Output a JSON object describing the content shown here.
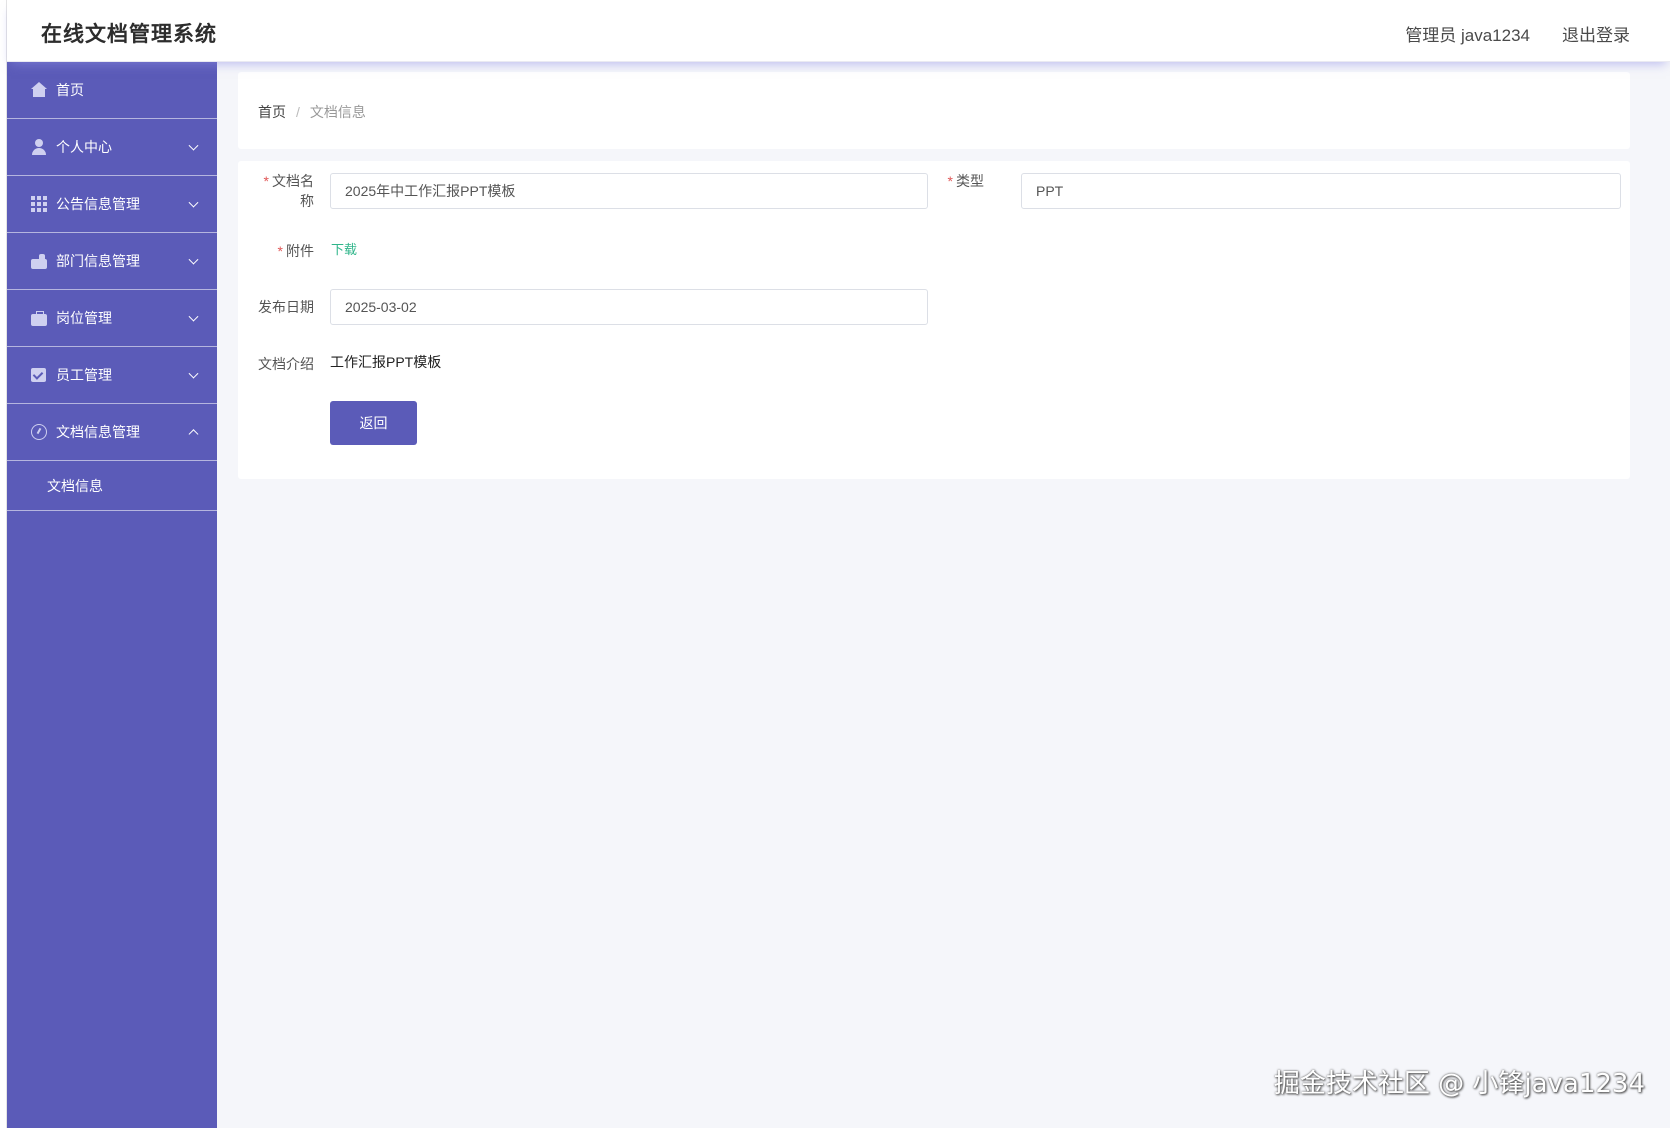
{
  "header": {
    "app_title": "在线文档管理系统",
    "user": "管理员 java1234",
    "logout": "退出登录"
  },
  "sidebar": {
    "items": [
      {
        "label": "首页",
        "icon": "home-icon"
      },
      {
        "label": "个人中心",
        "icon": "user-icon"
      },
      {
        "label": "公告信息管理",
        "icon": "grid-icon"
      },
      {
        "label": "部门信息管理",
        "icon": "thumb-icon"
      },
      {
        "label": "岗位管理",
        "icon": "briefcase-icon"
      },
      {
        "label": "员工管理",
        "icon": "checkbox-icon"
      },
      {
        "label": "文档信息管理",
        "icon": "gauge-icon"
      }
    ],
    "submenu": [
      "文档信息"
    ]
  },
  "breadcrumb": {
    "home": "首页",
    "separator": "/",
    "current": "文档信息"
  },
  "form": {
    "required_mark": "*",
    "doc_name_label": "文档名称",
    "doc_name_value": "2025年中工作汇报PPT模板",
    "type_label": "类型",
    "type_value": "PPT",
    "attachment_label": "附件",
    "attachment_link": "下载",
    "date_label": "发布日期",
    "date_value": "2025-03-02",
    "intro_label": "文档介绍",
    "intro_value": "工作汇报PPT模板",
    "back_button": "返回"
  },
  "watermark": "掘金技术社区 @ 小锋java1234",
  "colors": {
    "sidebar": "#5b5bb8",
    "primary_button": "#5b5bb8",
    "link": "#2fb58a",
    "required": "#e05656"
  }
}
